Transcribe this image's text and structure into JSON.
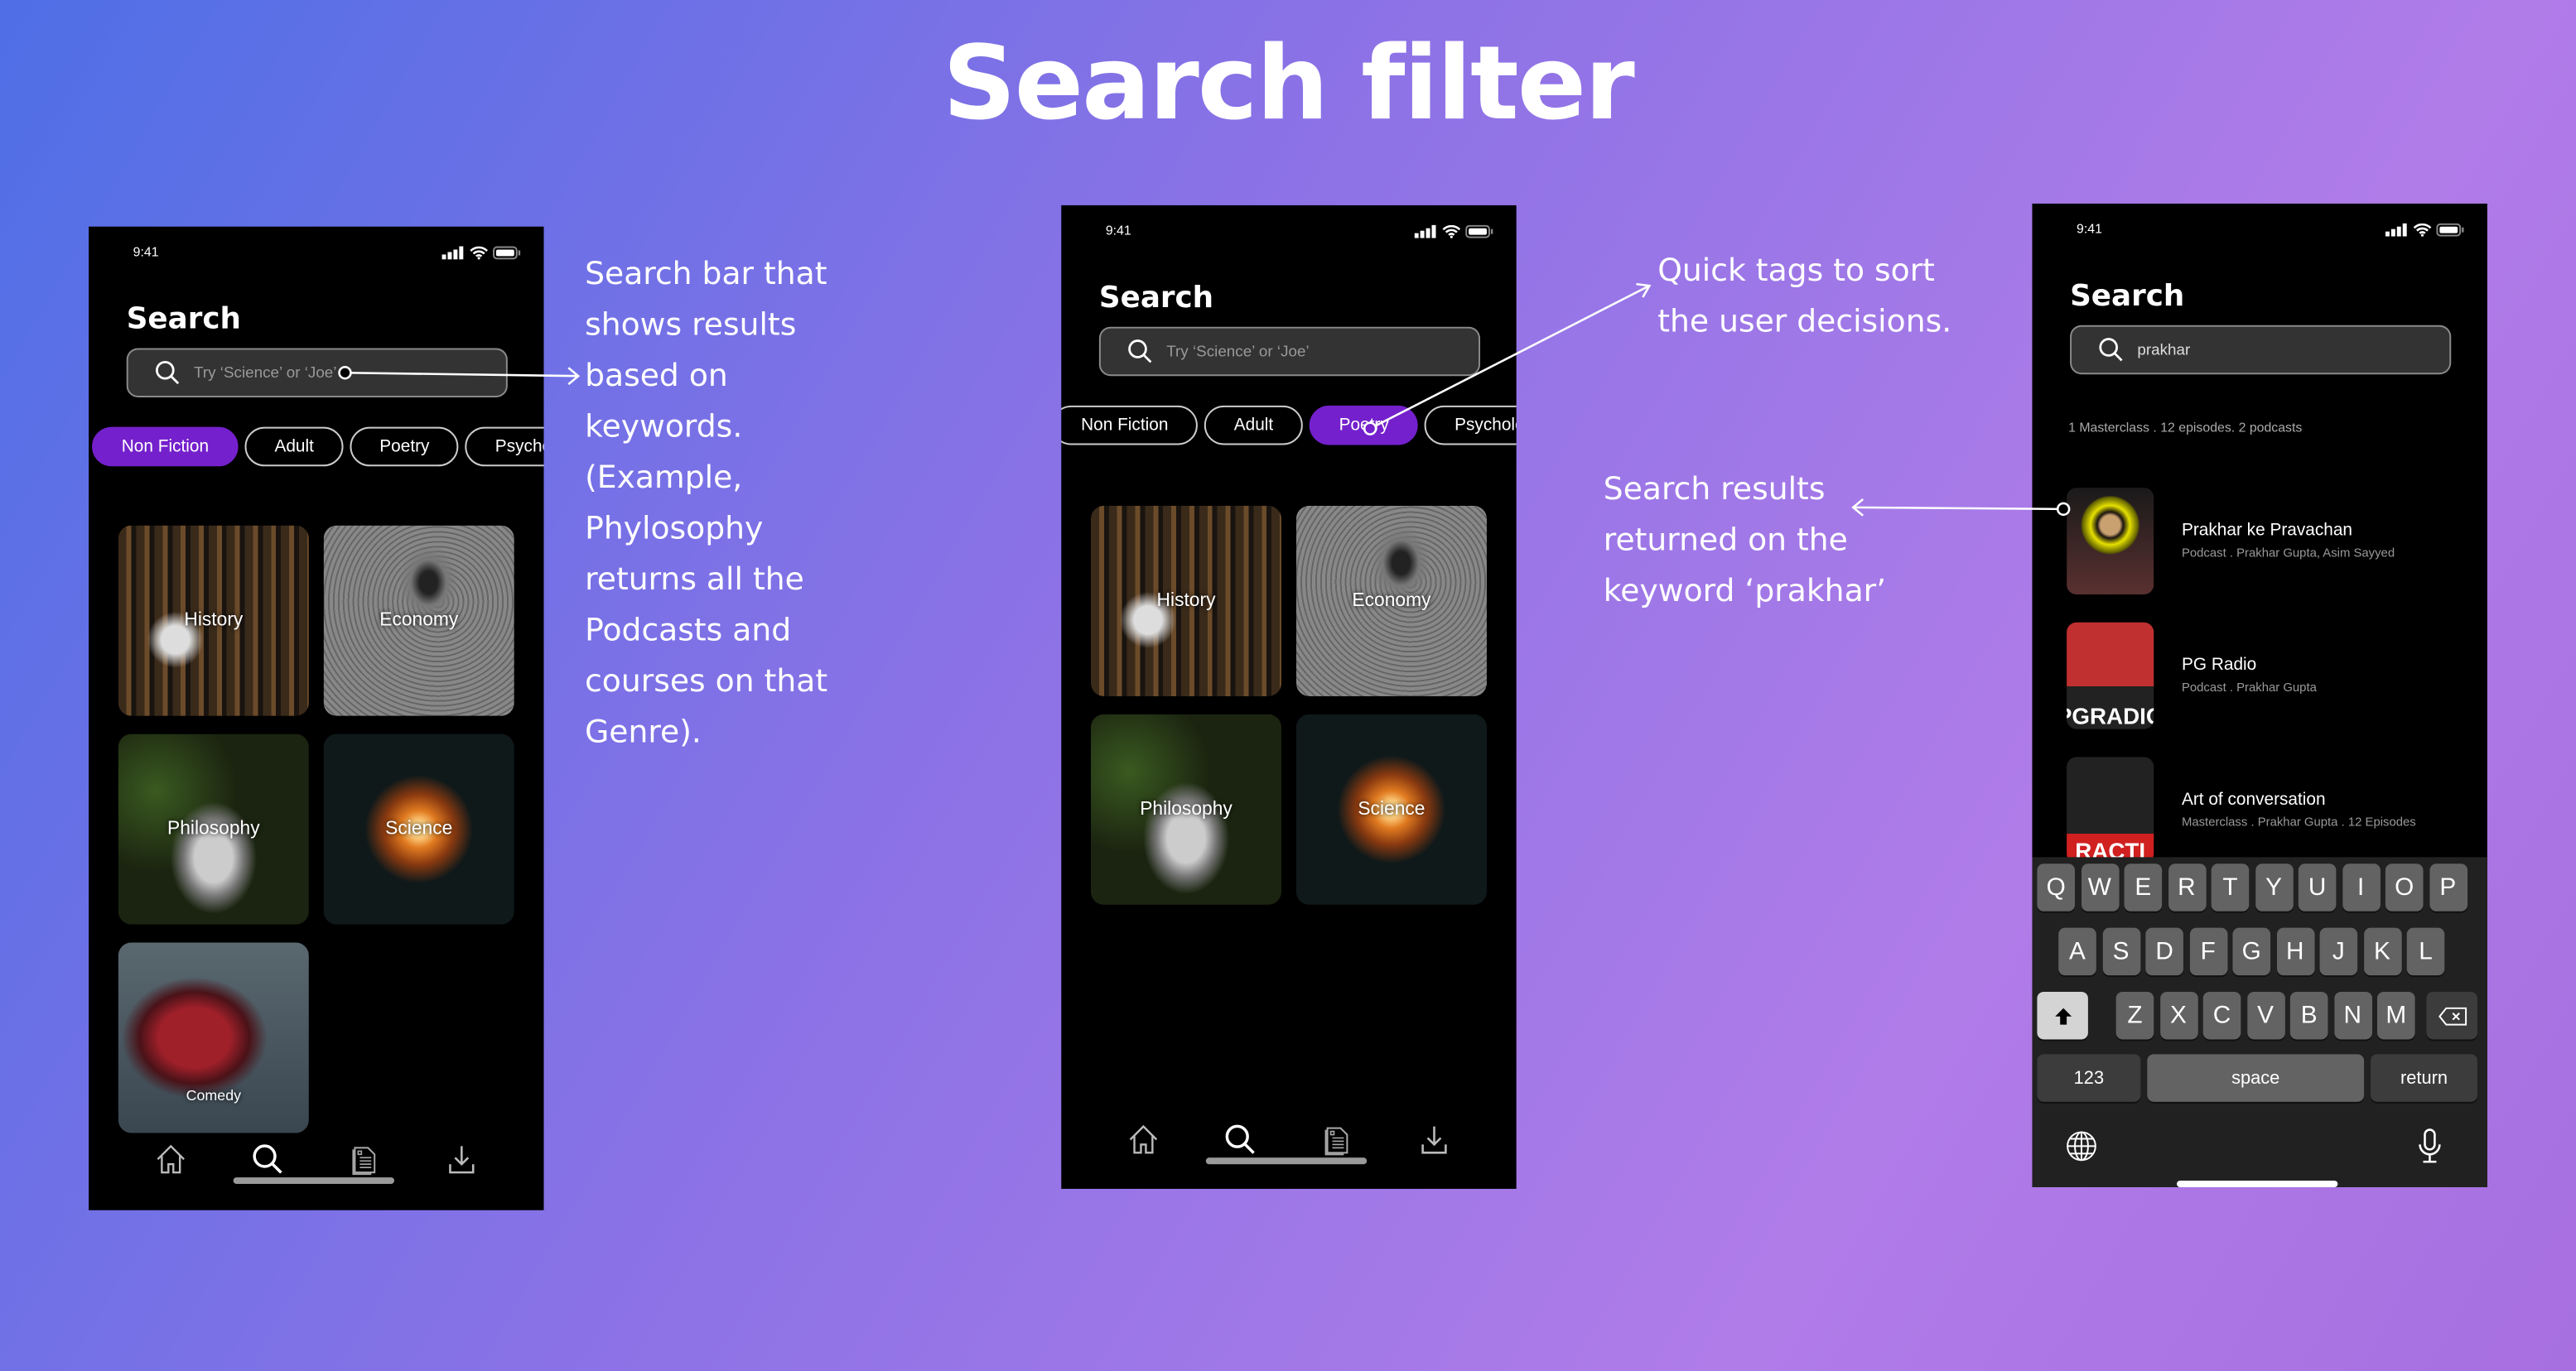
{
  "page_title": "Search filter",
  "annotations": {
    "search_bar": [
      "Search bar that",
      "shows results",
      "based on",
      "keywords.",
      "(Example,",
      "Phylosophy",
      "returns all the",
      "Podcasts and",
      "courses on that",
      "Genre)."
    ],
    "quick_tags": [
      "Quick tags to sort",
      "the user decisions."
    ],
    "results": [
      "Search results",
      "returned on the",
      "keyword ‘prakhar’"
    ]
  },
  "status_time": "9:41",
  "screen_title": "Search",
  "search_placeholder": "Try ‘Science’ or  ‘Joe’",
  "search_value": "prakhar",
  "chips": [
    "Non Fiction",
    "Adult",
    "Poetry",
    "Psychology"
  ],
  "phone1_active_chip": "Non Fiction",
  "phone2_active_chip": "Poetry",
  "accent_color": "#7420cc",
  "genres": [
    "History",
    "Economy",
    "Philosophy",
    "Science",
    "Comedy"
  ],
  "results_summary": "1 Masterclass . 12 episodes. 2 podcasts",
  "results": [
    {
      "title": "Prakhar ke Pravachan",
      "subtitle": "Podcast . Prakhar Gupta, Asim Sayyed"
    },
    {
      "title": "PG Radio",
      "subtitle": "Podcast . Prakhar Gupta",
      "thumb_text": "PGRADIO"
    },
    {
      "title": "Art of conversation",
      "subtitle": "Masterclass . Prakhar Gupta . 12 Episodes",
      "thumb_text": "RACTI"
    }
  ],
  "keyboard": {
    "rows": [
      [
        "Q",
        "W",
        "E",
        "R",
        "T",
        "Y",
        "U",
        "I",
        "O",
        "P"
      ],
      [
        "A",
        "S",
        "D",
        "F",
        "G",
        "H",
        "J",
        "K",
        "L"
      ],
      [
        "Z",
        "X",
        "C",
        "V",
        "B",
        "N",
        "M"
      ]
    ],
    "numbers": "123",
    "space": "space",
    "return": "return"
  },
  "nav_icons": [
    "home-icon",
    "search-icon",
    "library-icon",
    "download-icon"
  ]
}
